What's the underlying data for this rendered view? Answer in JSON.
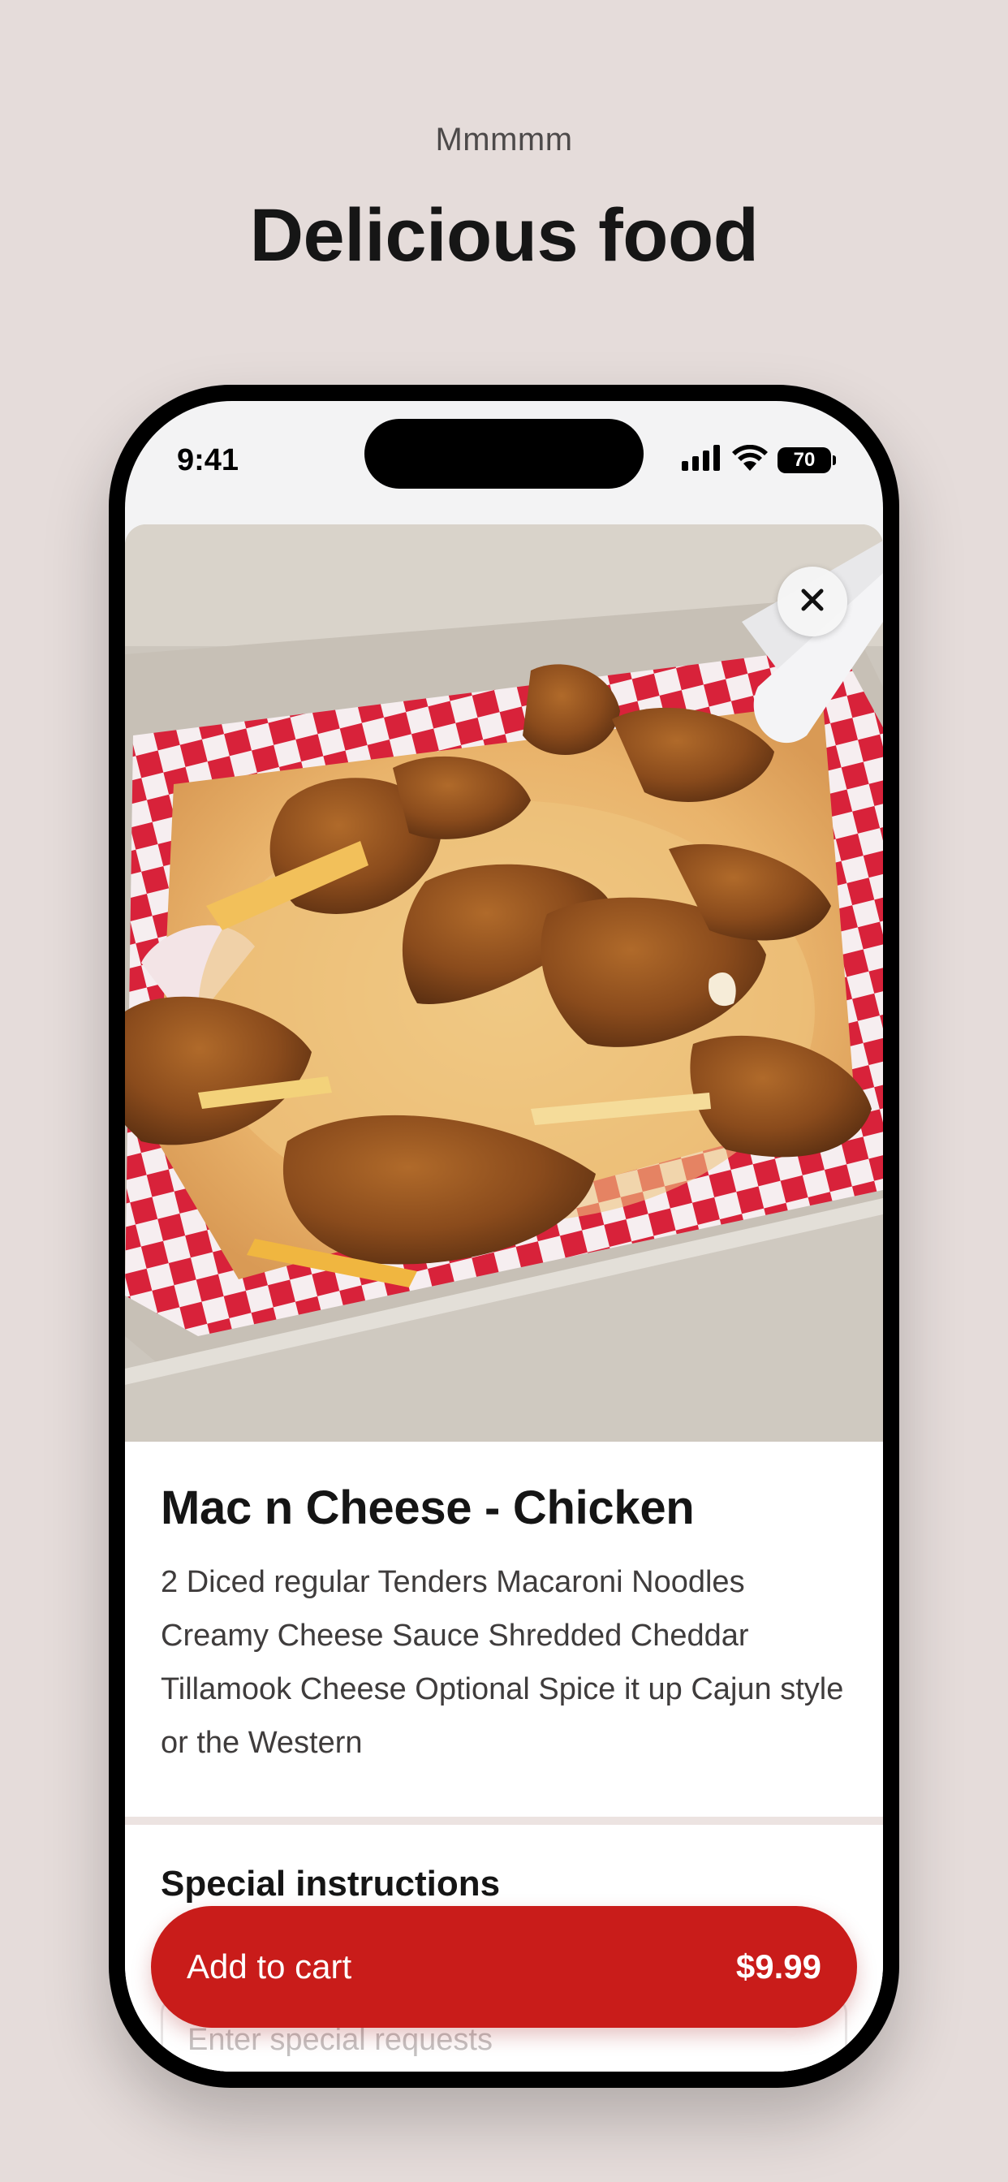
{
  "header": {
    "eyebrow": "Mmmmm",
    "headline": "Delicious food"
  },
  "status_bar": {
    "time": "9:41",
    "battery": "70"
  },
  "item": {
    "image_icon": "food-photo",
    "title": "Mac n Cheese - Chicken",
    "description": "2 Diced regular Tenders Macaroni Noodles Creamy Cheese Sauce Shredded Cheddar Tillamook Cheese Optional Spice it up Cajun style or the Western"
  },
  "special_instructions": {
    "title": "Special instructions",
    "placeholder": "Enter special requests"
  },
  "cart": {
    "label": "Add to cart",
    "price": "$9.99"
  },
  "colors": {
    "background": "#e5dcda",
    "accent": "#c91c1a"
  }
}
